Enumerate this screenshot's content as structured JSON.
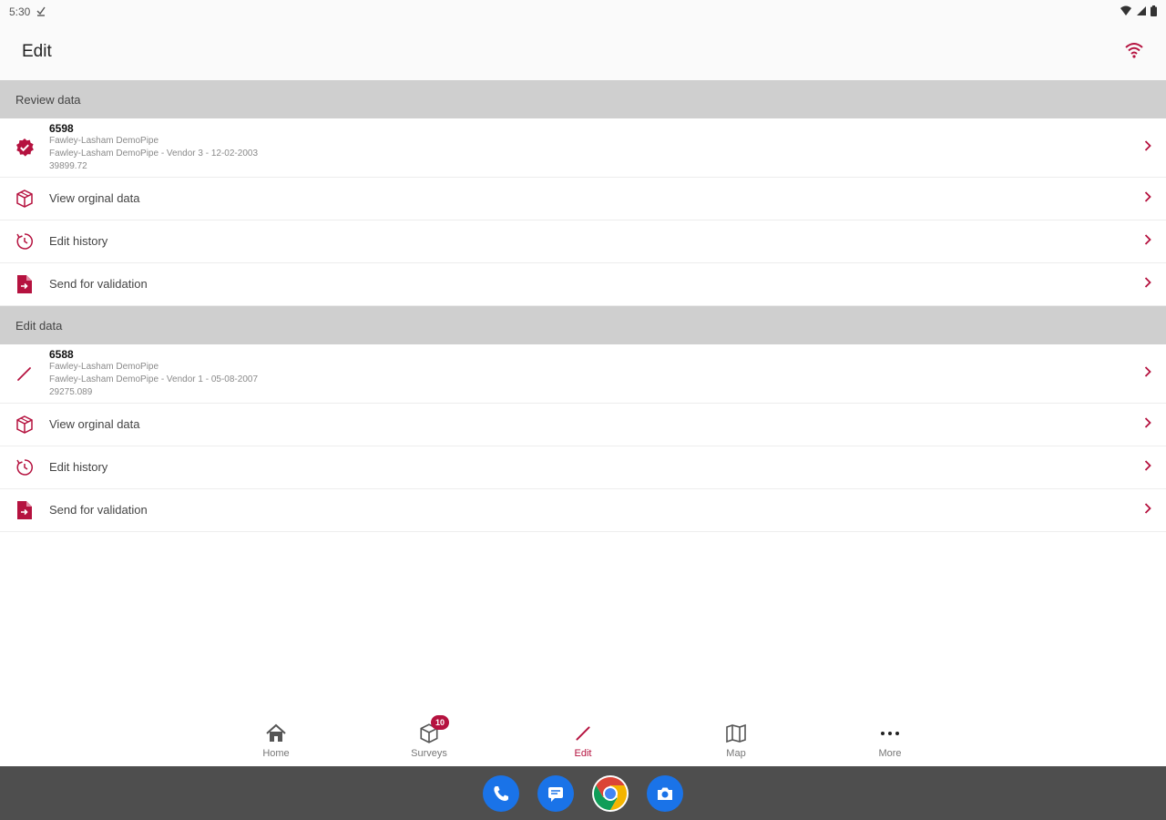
{
  "status": {
    "time": "5:30"
  },
  "app_bar": {
    "title": "Edit"
  },
  "sections": [
    {
      "header": "Review data",
      "record": {
        "id": "6598",
        "line1": "Fawley-Lasham DemoPipe",
        "line2": "Fawley-Lasham DemoPipe - Vendor 3 - 12-02-2003",
        "line3": "39899.72"
      },
      "actions": [
        {
          "label": "View orginal data",
          "icon": "cube-icon"
        },
        {
          "label": "Edit history",
          "icon": "history-icon"
        },
        {
          "label": "Send for validation",
          "icon": "send-document-icon"
        }
      ]
    },
    {
      "header": "Edit data",
      "record": {
        "id": "6588",
        "line1": "Fawley-Lasham DemoPipe",
        "line2": "Fawley-Lasham DemoPipe - Vendor 1 - 05-08-2007",
        "line3": "29275.089"
      },
      "actions": [
        {
          "label": "View orginal data",
          "icon": "cube-icon"
        },
        {
          "label": "Edit history",
          "icon": "history-icon"
        },
        {
          "label": "Send for validation",
          "icon": "send-document-icon"
        }
      ]
    }
  ],
  "bottom_nav": {
    "items": [
      {
        "label": "Home",
        "icon": "home-icon"
      },
      {
        "label": "Surveys",
        "icon": "cube-icon",
        "badge": "10"
      },
      {
        "label": "Edit",
        "icon": "pencil-icon",
        "active": true
      },
      {
        "label": "Map",
        "icon": "map-icon"
      },
      {
        "label": "More",
        "icon": "more-icon"
      }
    ]
  },
  "dock": [
    "phone-icon",
    "messages-icon",
    "chrome-icon",
    "camera-icon"
  ],
  "colors": {
    "accent": "#b5123f",
    "section_header_bg": "#cfcfcf",
    "system_bar_bg": "#4e4e4e"
  }
}
